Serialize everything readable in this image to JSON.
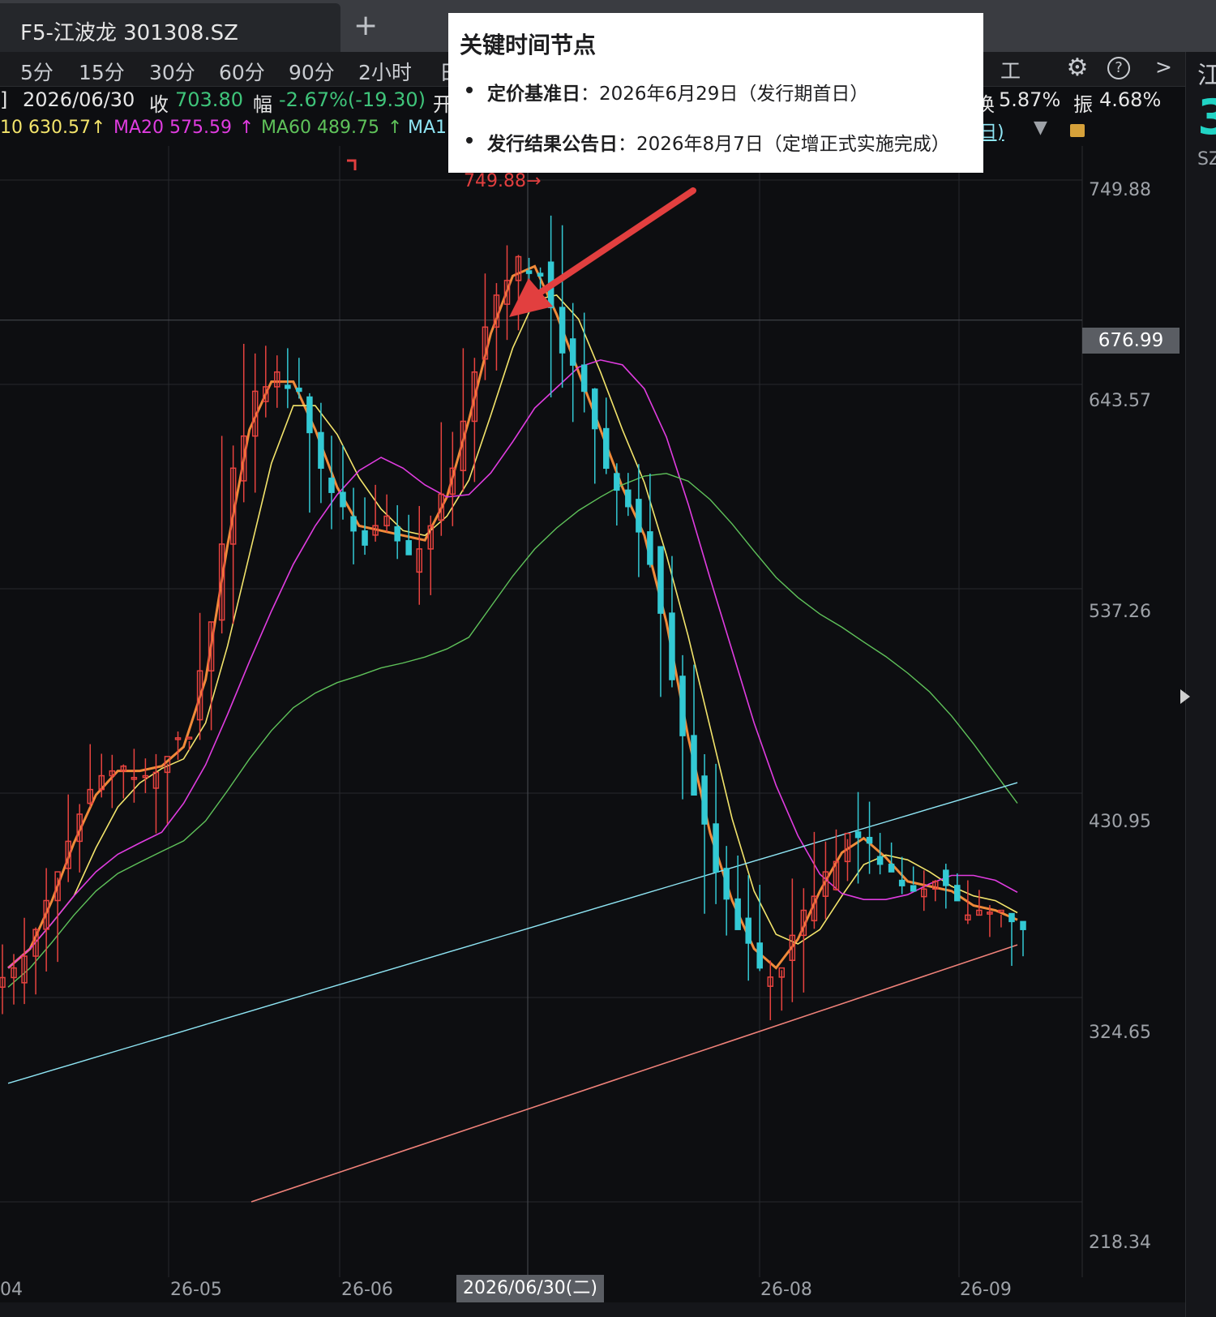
{
  "tab": {
    "title": "F5-江波龙 301308.SZ",
    "add": "+"
  },
  "periods": [
    "5分",
    "15分",
    "30分",
    "60分",
    "90分",
    "2小时",
    "日"
  ],
  "toolbar": {
    "tools": "工具",
    "settings_icon": "gear-icon",
    "help": "?",
    "more": ">"
  },
  "info": {
    "bracket": "]",
    "date": "2026/06/30",
    "close_label": "收",
    "close_value": "703.80",
    "change_label": "幅",
    "change_value": "-2.67%(-19.30)",
    "open_label": "开",
    "turnover_label": "换",
    "turnover_value": "5.87%",
    "amplitude_label": "振",
    "amplitude_value": "4.68%"
  },
  "ma": {
    "ma10": "10 630.57",
    "ma10_arrow": "↑",
    "ma20": "MA20 575.59",
    "ma20_arrow": "↑",
    "ma60": "MA60 489.75",
    "ma60_arrow": "↑",
    "ma120": "MA1",
    "right_text": "日)"
  },
  "popup": {
    "title": "关键时间节点",
    "items": [
      {
        "label": "定价基准日",
        "text": "：2026年6月29日（发行期首日）"
      },
      {
        "label": "发行结果公告日",
        "text": "：2026年8月7日（定增正式实施完成）"
      }
    ]
  },
  "price_axis": [
    "749.88",
    "643.57",
    "537.26",
    "430.95",
    "324.65",
    "218.34"
  ],
  "current_price": "676.99",
  "max_marker": "749.88",
  "date_axis": [
    "04",
    "26-05",
    "26-06",
    "26-08",
    "26-09"
  ],
  "date_cursor": "2026/06/30(二)",
  "right_panel": {
    "a": "江",
    "b": "3",
    "c": "SZ"
  },
  "colors": {
    "up": "#e8433f",
    "down": "#33c9d4",
    "ma5": "#f08b3a",
    "ma10": "#f3e46b",
    "ma20": "#e03ce0",
    "ma60": "#5fc25a",
    "ma120": "#8fe6f5",
    "ma250": "#f0827a",
    "annotation": "#e23f3f"
  },
  "chart_data": {
    "type": "candlestick",
    "price_range": [
      218.34,
      749.88
    ],
    "max_price": 749.88,
    "current_price": 676.99,
    "x_labels": [
      "04",
      "26-05",
      "26-06",
      "2026/06/30(二)",
      "26-08",
      "26-09"
    ],
    "close_path": [
      340,
      360,
      390,
      420,
      440,
      445,
      440,
      450,
      460,
      520,
      600,
      640,
      650,
      640,
      600,
      580,
      560,
      575,
      555,
      570,
      600,
      650,
      690,
      710,
      700,
      660,
      640,
      600,
      580,
      550,
      490,
      430,
      390,
      360,
      340,
      340,
      370,
      390,
      410,
      405,
      390,
      380,
      385,
      375,
      370,
      370,
      360
    ],
    "ma_latest": {
      "MA10": 630.57,
      "MA20": 575.59,
      "MA60": 489.75
    }
  }
}
